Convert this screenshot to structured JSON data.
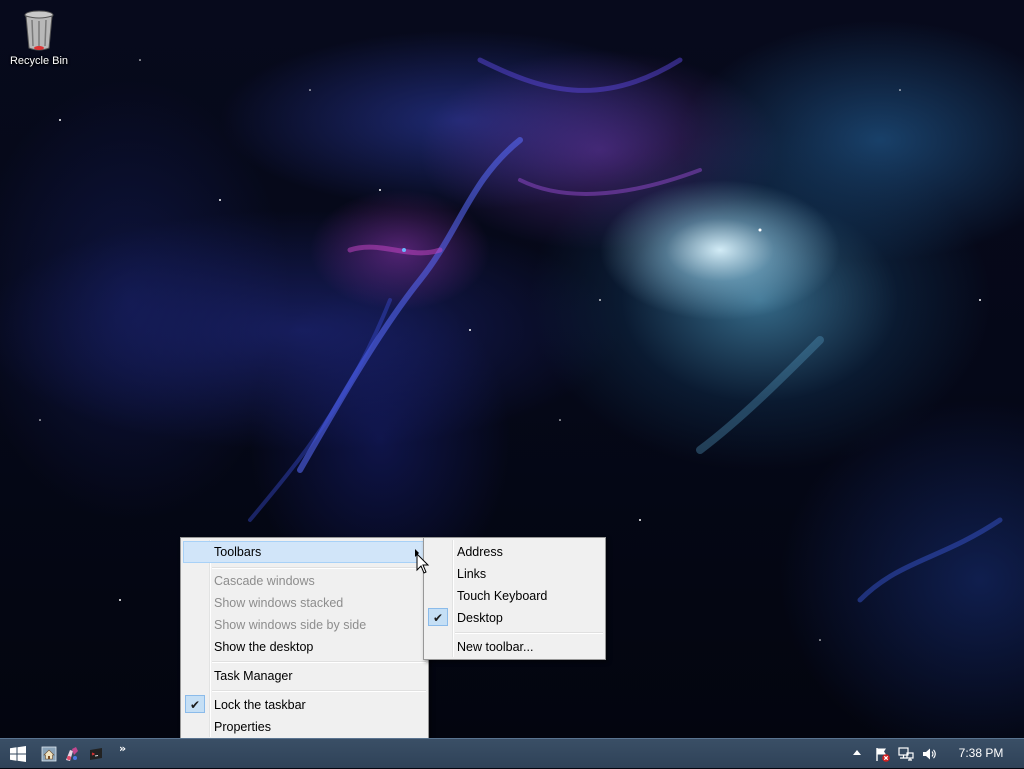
{
  "desktop": {
    "icons": [
      {
        "label": "Recycle Bin",
        "icon": "recycle-bin-icon"
      }
    ]
  },
  "context_menu": {
    "items": [
      {
        "label": "Toolbars",
        "state": "highlighted",
        "has_submenu": true
      },
      {
        "label": "Cascade windows",
        "state": "disabled"
      },
      {
        "label": "Show windows stacked",
        "state": "disabled"
      },
      {
        "label": "Show windows side by side",
        "state": "disabled"
      },
      {
        "label": "Show the desktop",
        "state": "enabled"
      },
      {
        "label": "Task Manager",
        "state": "enabled"
      },
      {
        "label": "Lock the taskbar",
        "state": "enabled",
        "checked": true
      },
      {
        "label": "Properties",
        "state": "enabled"
      }
    ]
  },
  "toolbars_submenu": {
    "items": [
      {
        "label": "Address",
        "checked": false
      },
      {
        "label": "Links",
        "checked": false
      },
      {
        "label": "Touch Keyboard",
        "checked": false
      },
      {
        "label": "Desktop",
        "checked": true
      },
      {
        "label": "New toolbar...",
        "checked": false
      }
    ]
  },
  "taskbar": {
    "start_icon": "windows-logo-icon",
    "quick_launch": [
      "home-icon",
      "paint-icon",
      "terminal-icon"
    ],
    "overflow_chevron": "»",
    "tray_icons": [
      "show-hidden-icons-arrow",
      "action-center-flag-icon",
      "network-icon",
      "volume-icon"
    ],
    "clock": "7:38 PM"
  },
  "colors": {
    "taskbar": "#2f4258",
    "menu_background": "#f0f0f0",
    "menu_highlight": "#d1e5f9",
    "menu_highlight_border": "#a8d1f7",
    "disabled_text": "#8d8d8d"
  }
}
